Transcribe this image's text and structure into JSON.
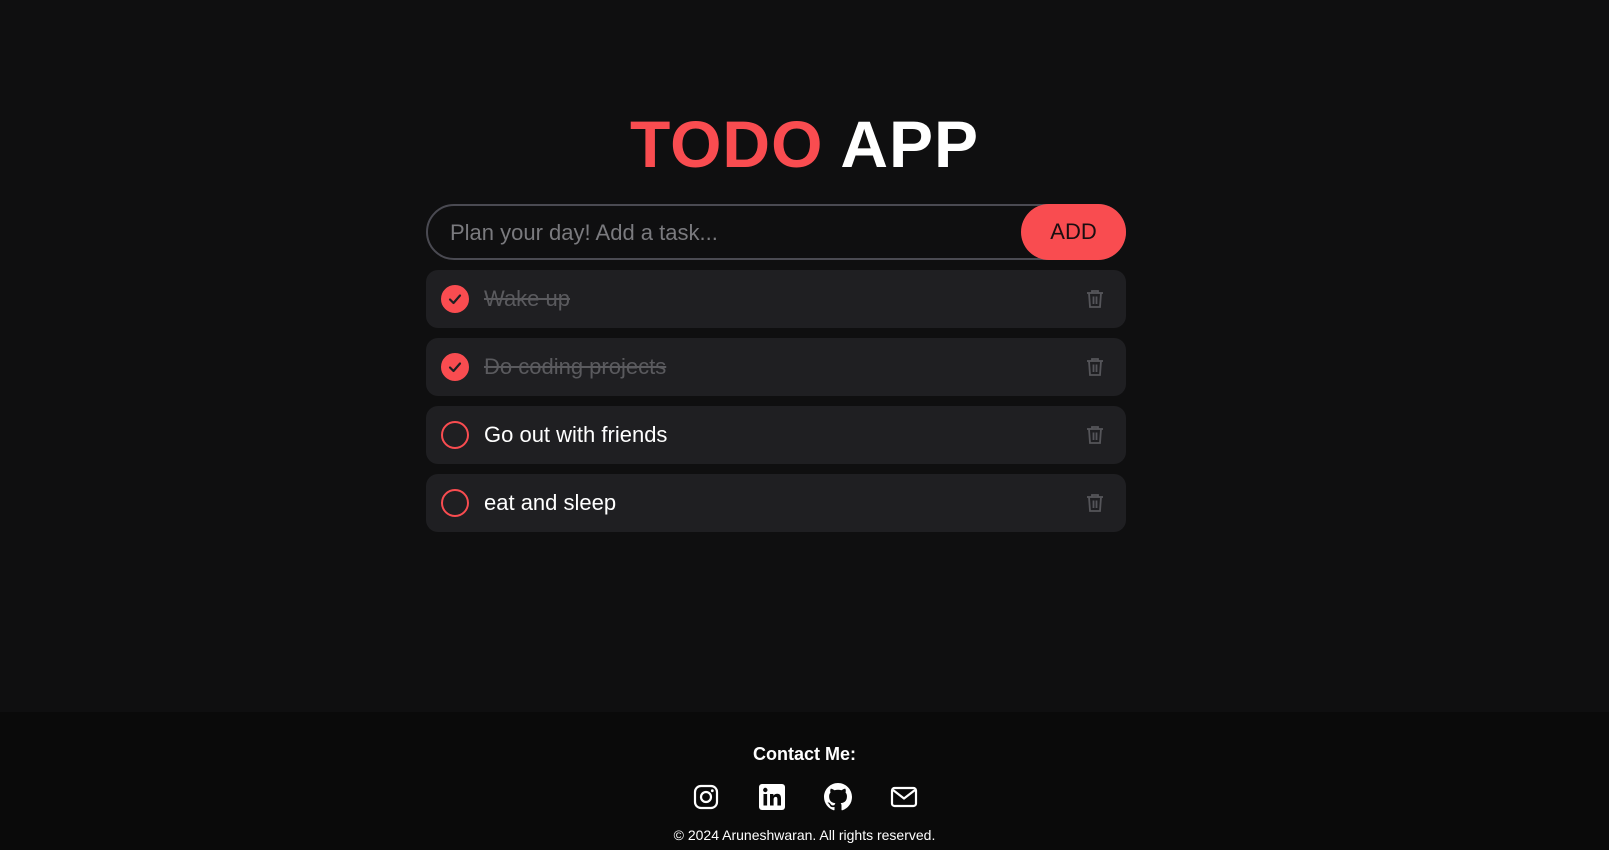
{
  "header": {
    "title_part1": "TODO",
    "title_part2": "APP"
  },
  "input": {
    "placeholder": "Plan your day! Add a task...",
    "value": "",
    "add_label": "ADD"
  },
  "tasks": [
    {
      "label": "Wake up",
      "completed": true
    },
    {
      "label": "Do coding projects",
      "completed": true
    },
    {
      "label": "Go out with friends",
      "completed": false
    },
    {
      "label": "eat and sleep",
      "completed": false
    }
  ],
  "footer": {
    "contact_label": "Contact Me:",
    "socials": [
      "instagram-icon",
      "linkedin-icon",
      "github-icon",
      "mail-icon"
    ],
    "copyright": "© 2024 Aruneshwaran. All rights reserved."
  },
  "colors": {
    "accent": "#f94c50",
    "background": "#0f0f10",
    "card": "#1f1f22"
  }
}
